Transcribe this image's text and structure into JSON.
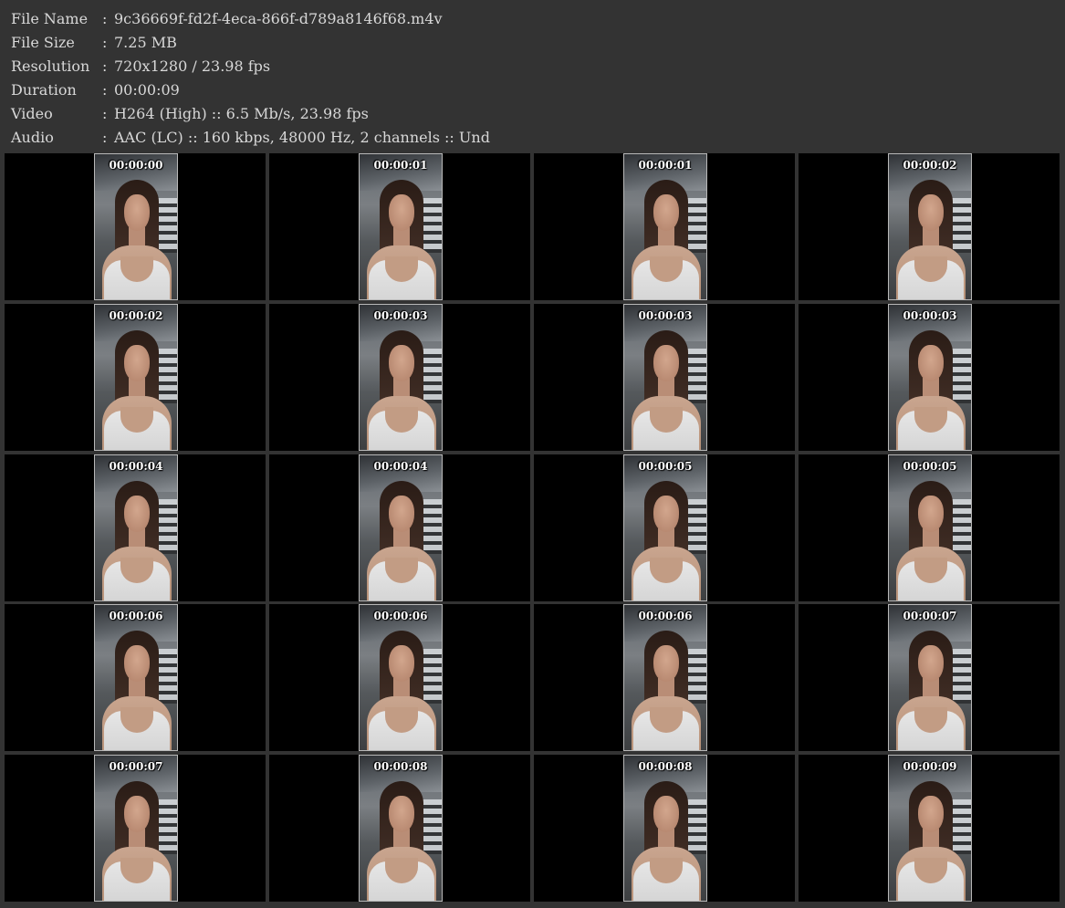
{
  "info": {
    "rows": [
      {
        "key": "File Name",
        "sep": ":",
        "value": "9c36669f-fd2f-4eca-866f-d789a8146f68.m4v"
      },
      {
        "key": "File Size",
        "sep": ":",
        "value": "7.25 MB"
      },
      {
        "key": "Resolution",
        "sep": ":",
        "value": "720x1280 / 23.98 fps"
      },
      {
        "key": "Duration",
        "sep": ":",
        "value": "00:00:09"
      },
      {
        "key": "Video",
        "sep": ":",
        "value": "H264 (High) :: 6.5 Mb/s, 23.98 fps"
      },
      {
        "key": "Audio",
        "sep": ":",
        "value": "AAC (LC) :: 160 kbps, 48000 Hz, 2 channels :: Und"
      }
    ]
  },
  "thumbnails": {
    "timestamps": [
      "00:00:00",
      "00:00:01",
      "00:00:01",
      "00:00:02",
      "00:00:02",
      "00:00:03",
      "00:00:03",
      "00:00:03",
      "00:00:04",
      "00:00:04",
      "00:00:05",
      "00:00:05",
      "00:00:06",
      "00:00:06",
      "00:00:06",
      "00:00:07",
      "00:00:07",
      "00:00:08",
      "00:00:08",
      "00:00:09"
    ]
  },
  "colors": {
    "background": "#333333",
    "cell": "#000000",
    "info_text": "#d8d8d8",
    "timestamp": "#ffffff"
  }
}
